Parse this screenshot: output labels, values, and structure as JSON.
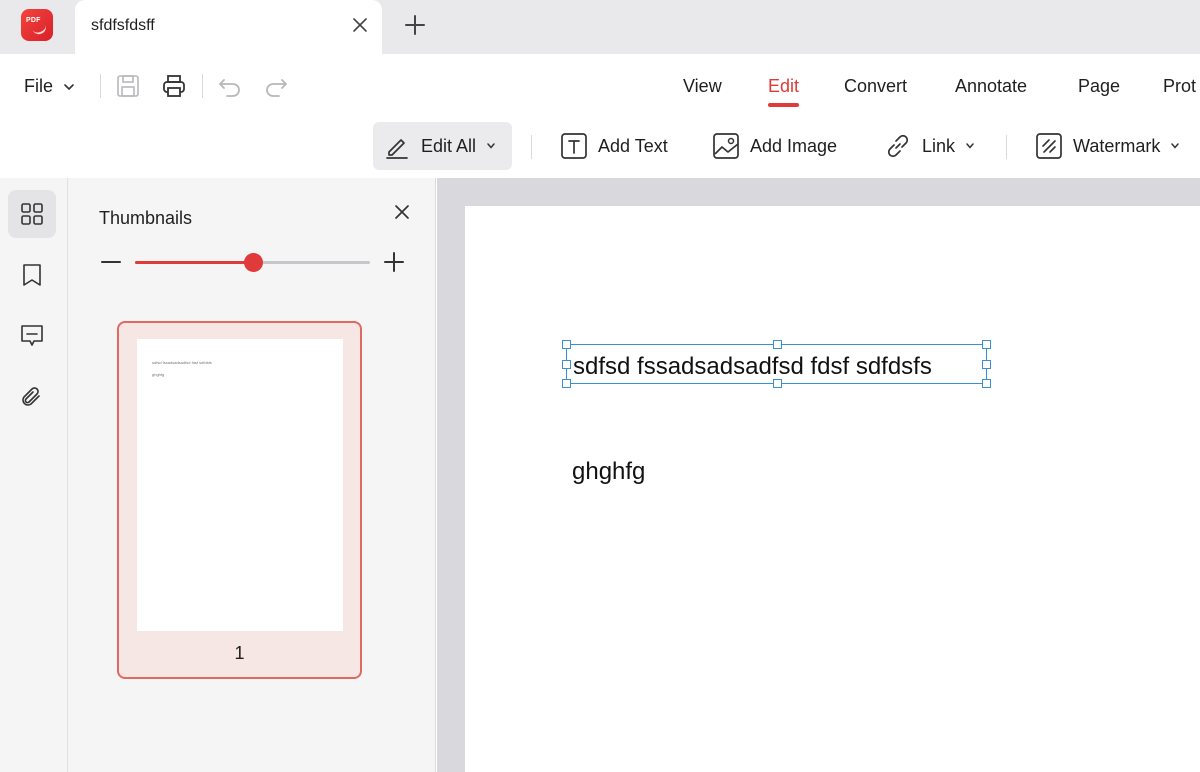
{
  "tabbar": {
    "logo_text": "PDF",
    "tab_title": "sfdfsfdsff"
  },
  "menubar": {
    "file_label": "File",
    "nav_tabs": [
      "View",
      "Edit",
      "Convert",
      "Annotate",
      "Page",
      "Prot"
    ],
    "active_tab": "Edit"
  },
  "toolbar": {
    "edit_all": "Edit All",
    "add_text": "Add Text",
    "add_image": "Add Image",
    "link": "Link",
    "watermark": "Watermark"
  },
  "rail": {
    "items": [
      "thumbnails-icon",
      "bookmark-icon",
      "comment-icon",
      "attachment-icon"
    ]
  },
  "thumbnails": {
    "title": "Thumbnails",
    "zoom_level_fraction": 0.5,
    "page_number": "1",
    "thumb_line1": "sdfsd fssadsadsadfsd fdsf sdfdsfs",
    "thumb_line2": "ghghfg"
  },
  "document": {
    "selected_text": "sdfsd fssadsadsadfsd fdsf sdfdsfs",
    "paragraph": "ghghfg"
  },
  "colors": {
    "accent": "#e03a3a",
    "selection": "#3a8fd9"
  }
}
